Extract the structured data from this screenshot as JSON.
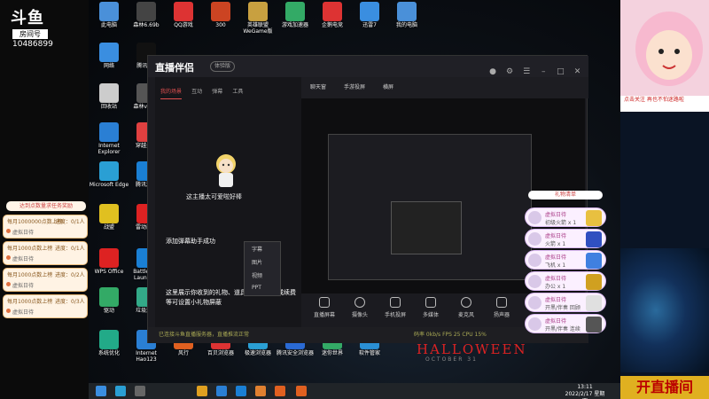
{
  "stream": {
    "logo": "斗鱼",
    "room_label": "房间号",
    "room_number": "10486899"
  },
  "desktop_icons": [
    {
      "label": "此电脑",
      "color": "#4a90d9"
    },
    {
      "label": "森林6.69b",
      "color": "#444"
    },
    {
      "label": "QQ游戏",
      "color": "#d33"
    },
    {
      "label": "300",
      "color": "#c42"
    },
    {
      "label": "英雄联盟 WeGame版",
      "color": "#c8a040"
    },
    {
      "label": "游戏加速器",
      "color": "#3a6"
    },
    {
      "label": "企鹅电竞",
      "color": "#d33"
    },
    {
      "label": "迅雷7",
      "color": "#3a8ee0"
    },
    {
      "label": "我的电脑",
      "color": "#4a90d9"
    },
    {
      "label": "网络",
      "color": "#3a8ee0"
    },
    {
      "label": "腾讯QQ",
      "color": "#111"
    },
    {
      "label": "回收站",
      "color": "#ccc"
    },
    {
      "label": "森林v0.66",
      "color": "#555"
    },
    {
      "label": "Internet Explorer",
      "color": "#2a7fd4"
    },
    {
      "label": "穿越火线",
      "color": "#e04040"
    },
    {
      "label": "Microsoft Edge",
      "color": "#2a9fd4"
    },
    {
      "label": "腾讯游戏",
      "color": "#1a7fd4"
    },
    {
      "label": "战盟",
      "color": "#e0c020"
    },
    {
      "label": "雷动商务",
      "color": "#d22"
    },
    {
      "label": "WPS Office",
      "color": "#d22"
    },
    {
      "label": "Battle.net Launcher",
      "color": "#1a7fd4"
    },
    {
      "label": "驱动",
      "color": "#3a6"
    },
    {
      "label": "垃圾清理",
      "color": "#3a8"
    },
    {
      "label": "系统优化",
      "color": "#2a8"
    },
    {
      "label": "Internet Hao123",
      "color": "#2a7fd4"
    },
    {
      "label": "风行",
      "color": "#e06020"
    },
    {
      "label": "百贝浏览器",
      "color": "#d33"
    },
    {
      "label": "极速浏览器",
      "color": "#2a9fd4"
    },
    {
      "label": "腾讯安全浏览器",
      "color": "#2a6ad4"
    },
    {
      "label": "迷你世界",
      "color": "#3a6"
    },
    {
      "label": "软件管家",
      "color": "#2a8fd4"
    }
  ],
  "task_panel": {
    "header": "达到点数量求任务奖励",
    "tasks": [
      {
        "title": "每月1000000点数上榜",
        "progress": "进度：0/1人",
        "status": "虚拟日待"
      },
      {
        "title": "每月1000点数上榜",
        "progress": "进度：0/1人",
        "status": "虚拟日待"
      },
      {
        "title": "每月1000点数上榜",
        "progress": "进度：0/2人",
        "status": "虚拟日待"
      },
      {
        "title": "每月1000点数上榜",
        "progress": "进度：0/3人",
        "status": "虚拟日待"
      }
    ]
  },
  "main_window": {
    "logo": "直播伴侣",
    "beta": "体验版",
    "left_tabs": [
      "我的场景",
      "互动",
      "弹幕",
      "工具"
    ],
    "mascot_caption": "这主播太可爱啦好棒",
    "msg1": "添加弹幕助手成功",
    "msg2": "这里展示你收到的礼物、道具、贵族开通或续费等可设置小礼物屏蔽",
    "warning": "已连接斗鱼直播服务器，直播推流正常",
    "top_tabs": [
      "聊天窗",
      "手游投屏",
      "横屏"
    ],
    "context_menu": [
      "字幕",
      "图片",
      "视频",
      "PPT"
    ],
    "toolbar": [
      {
        "label": "直播屏幕"
      },
      {
        "label": "摄像头"
      },
      {
        "label": "手机投屏"
      },
      {
        "label": "多媒体"
      },
      {
        "label": "麦克风"
      },
      {
        "label": "扬声器"
      }
    ],
    "stats": "码率 0kb/s  FPS 25  CPU 15%"
  },
  "gift_panel": {
    "header": "礼物清单",
    "gifts": [
      {
        "name": "虚拟日待",
        "text": "初级火箭 x 1",
        "icon_color": "#e8c040"
      },
      {
        "name": "虚拟日待",
        "text": "火箭 x 1",
        "icon_color": "#3050c0"
      },
      {
        "name": "虚拟日待",
        "text": "飞机 x 1",
        "icon_color": "#4080e0"
      },
      {
        "name": "虚拟日待",
        "text": "办公 x 1",
        "icon_color": "#d0a020"
      },
      {
        "name": "虚拟日待",
        "text": "开黑/伴奏 回顾",
        "icon_color": "#e0e0e0"
      },
      {
        "name": "虚拟日待",
        "text": "开黑/伴奏 连续",
        "icon_color": "#555"
      }
    ]
  },
  "right_col": {
    "follow": "点击关注 再也不怕迷路啦",
    "live_banner": "开直播间"
  },
  "halloween": "HALLOWEEN",
  "halloween_sub": "OCTOBER 31",
  "taskbar": {
    "time": "13:11",
    "date": "2022/2/17 星期四"
  }
}
